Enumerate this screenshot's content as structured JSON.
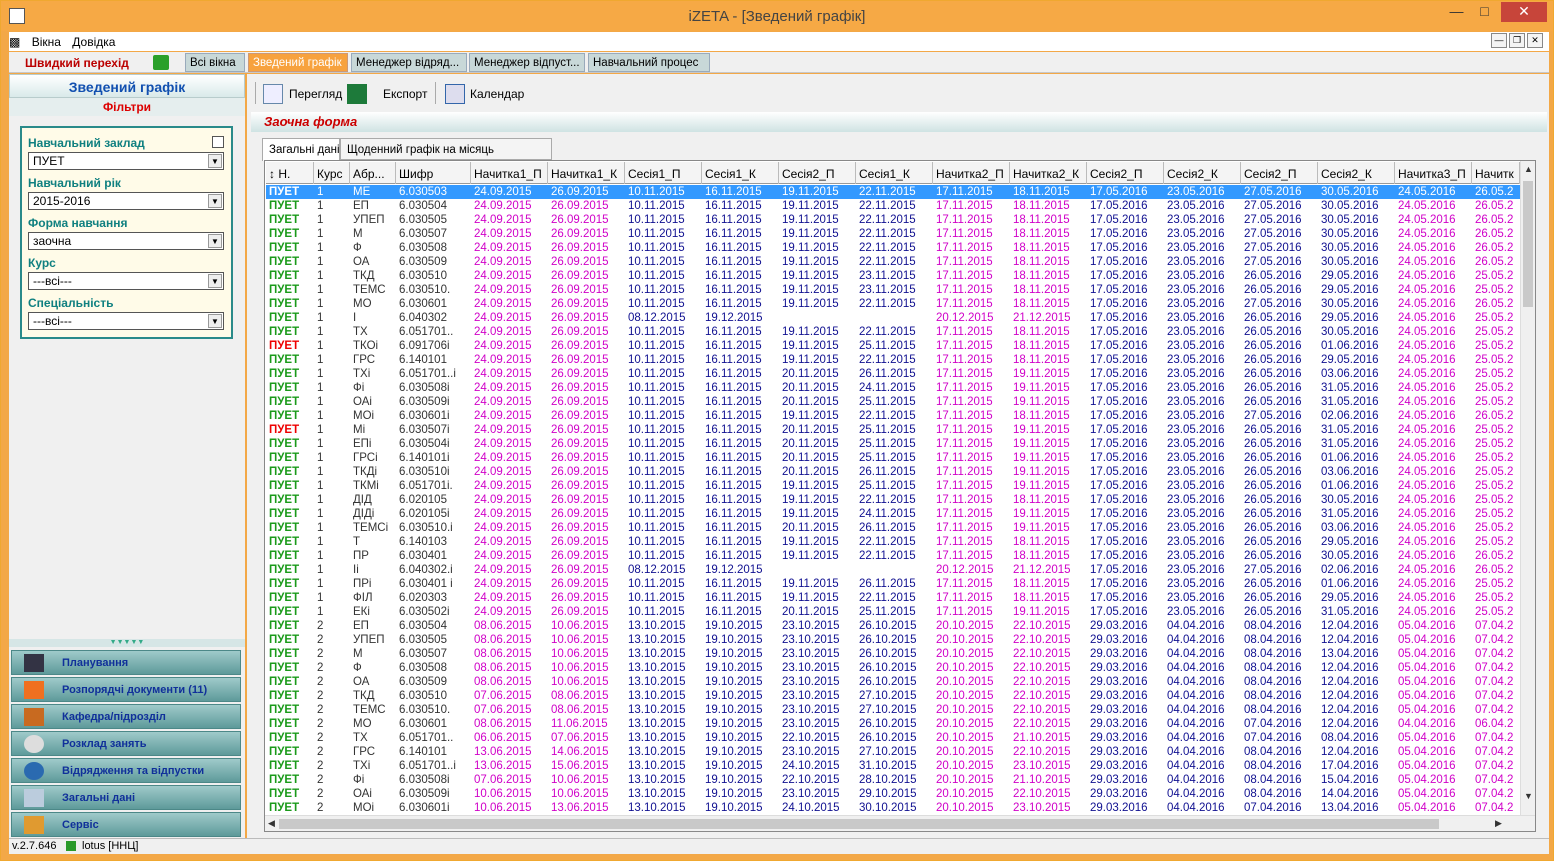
{
  "window": {
    "title": "iZETA - [Зведений графік]"
  },
  "menu": {
    "items": [
      "Вікна",
      "Довідка"
    ]
  },
  "quickbar": {
    "label": "Швидкий перехід",
    "tabs": [
      "Всі вікна",
      "Зведений графік",
      "Менеджер відряд...",
      "Менеджер відпуст...",
      "Навчальний процес"
    ],
    "active": 1
  },
  "leftpanel": {
    "title": "Зведений графік",
    "filters_title": "Фільтри",
    "filters": [
      {
        "label": "Навчальний заклад",
        "value": "ПУЕТ"
      },
      {
        "label": "Навчальний рік",
        "value": "2015-2016"
      },
      {
        "label": "Форма навчання",
        "value": "заочна"
      },
      {
        "label": "Курс",
        "value": "---всі---"
      },
      {
        "label": "Спеціальність",
        "value": "---всі---"
      }
    ],
    "nav": [
      {
        "label": "Планування",
        "icon": "graduation-icon"
      },
      {
        "label": "Розпорядчі документи (11)",
        "icon": "mail-icon"
      },
      {
        "label": "Кафедра/підрозділ",
        "icon": "briefcase-icon"
      },
      {
        "label": "Розклад занять",
        "icon": "clock-icon"
      },
      {
        "label": "Відрядження та відпустки",
        "icon": "globe-icon"
      },
      {
        "label": "Загальні дані",
        "icon": "list-icon"
      },
      {
        "label": "Сервіс",
        "icon": "tools-icon"
      }
    ]
  },
  "status": {
    "version": "v.2.7.646",
    "user": "lotus [ННЦ]"
  },
  "toolbar": {
    "preview": "Перегляд",
    "export": "Експорт",
    "calendar": "Календар"
  },
  "form_title": "Заочна форма",
  "tabs": [
    "Загальні дані",
    "Щоденний графік на місяць"
  ],
  "grid": {
    "columns": [
      "Н.",
      "Курс",
      "Абр...",
      "Шифр",
      "Начитка1_П",
      "Начитка1_К",
      "Сесія1_П",
      "Сесія1_К",
      "Сесія2_П",
      "Сесія1_К",
      "Начитка2_П",
      "Начитка2_К",
      "Сесія2_П",
      "Сесія2_К",
      "Сесія2_П",
      "Сесія2_К",
      "Начитка3_П",
      "Начитк"
    ],
    "rows": [
      [
        "ПУЕТ",
        "1",
        "МЕ",
        "6.030503",
        "24.09.2015",
        "26.09.2015",
        "10.11.2015",
        "16.11.2015",
        "19.11.2015",
        "22.11.2015",
        "17.11.2015",
        "18.11.2015",
        "17.05.2016",
        "23.05.2016",
        "27.05.2016",
        "30.05.2016",
        "24.05.2016",
        "26.05.2"
      ],
      [
        "ПУЕТ",
        "1",
        "ЕП",
        "6.030504",
        "24.09.2015",
        "26.09.2015",
        "10.11.2015",
        "16.11.2015",
        "19.11.2015",
        "22.11.2015",
        "17.11.2015",
        "18.11.2015",
        "17.05.2016",
        "23.05.2016",
        "27.05.2016",
        "30.05.2016",
        "24.05.2016",
        "26.05.2"
      ],
      [
        "ПУЕТ",
        "1",
        "УПЕП",
        "6.030505",
        "24.09.2015",
        "26.09.2015",
        "10.11.2015",
        "16.11.2015",
        "19.11.2015",
        "22.11.2015",
        "17.11.2015",
        "18.11.2015",
        "17.05.2016",
        "23.05.2016",
        "27.05.2016",
        "30.05.2016",
        "24.05.2016",
        "26.05.2"
      ],
      [
        "ПУЕТ",
        "1",
        "М",
        "6.030507",
        "24.09.2015",
        "26.09.2015",
        "10.11.2015",
        "16.11.2015",
        "19.11.2015",
        "22.11.2015",
        "17.11.2015",
        "18.11.2015",
        "17.05.2016",
        "23.05.2016",
        "27.05.2016",
        "30.05.2016",
        "24.05.2016",
        "26.05.2"
      ],
      [
        "ПУЕТ",
        "1",
        "Ф",
        "6.030508",
        "24.09.2015",
        "26.09.2015",
        "10.11.2015",
        "16.11.2015",
        "19.11.2015",
        "22.11.2015",
        "17.11.2015",
        "18.11.2015",
        "17.05.2016",
        "23.05.2016",
        "27.05.2016",
        "30.05.2016",
        "24.05.2016",
        "26.05.2"
      ],
      [
        "ПУЕТ",
        "1",
        "ОА",
        "6.030509",
        "24.09.2015",
        "26.09.2015",
        "10.11.2015",
        "16.11.2015",
        "19.11.2015",
        "22.11.2015",
        "17.11.2015",
        "18.11.2015",
        "17.05.2016",
        "23.05.2016",
        "27.05.2016",
        "30.05.2016",
        "24.05.2016",
        "26.05.2"
      ],
      [
        "ПУЕТ",
        "1",
        "ТКД",
        "6.030510",
        "24.09.2015",
        "26.09.2015",
        "10.11.2015",
        "16.11.2015",
        "19.11.2015",
        "23.11.2015",
        "17.11.2015",
        "18.11.2015",
        "17.05.2016",
        "23.05.2016",
        "26.05.2016",
        "29.05.2016",
        "24.05.2016",
        "25.05.2"
      ],
      [
        "ПУЕТ",
        "1",
        "ТЕМС",
        "6.030510.",
        "24.09.2015",
        "26.09.2015",
        "10.11.2015",
        "16.11.2015",
        "19.11.2015",
        "23.11.2015",
        "17.11.2015",
        "18.11.2015",
        "17.05.2016",
        "23.05.2016",
        "26.05.2016",
        "29.05.2016",
        "24.05.2016",
        "25.05.2"
      ],
      [
        "ПУЕТ",
        "1",
        "МО",
        "6.030601",
        "24.09.2015",
        "26.09.2015",
        "10.11.2015",
        "16.11.2015",
        "19.11.2015",
        "22.11.2015",
        "17.11.2015",
        "18.11.2015",
        "17.05.2016",
        "23.05.2016",
        "27.05.2016",
        "30.05.2016",
        "24.05.2016",
        "26.05.2"
      ],
      [
        "ПУЕТ",
        "1",
        "І",
        "6.040302",
        "24.09.2015",
        "26.09.2015",
        "08.12.2015",
        "19.12.2015",
        "",
        "",
        "20.12.2015",
        "21.12.2015",
        "17.05.2016",
        "23.05.2016",
        "26.05.2016",
        "29.05.2016",
        "24.05.2016",
        "25.05.2"
      ],
      [
        "ПУЕТ",
        "1",
        "ТХ",
        "6.051701..",
        "24.09.2015",
        "26.09.2015",
        "10.11.2015",
        "16.11.2015",
        "19.11.2015",
        "22.11.2015",
        "17.11.2015",
        "18.11.2015",
        "17.05.2016",
        "23.05.2016",
        "26.05.2016",
        "30.05.2016",
        "24.05.2016",
        "25.05.2"
      ],
      [
        "ПУЕТ",
        "1",
        "ТКОі",
        "6.091706і",
        "24.09.2015",
        "26.09.2015",
        "10.11.2015",
        "16.11.2015",
        "19.11.2015",
        "25.11.2015",
        "17.11.2015",
        "18.11.2015",
        "17.05.2016",
        "23.05.2016",
        "26.05.2016",
        "01.06.2016",
        "24.05.2016",
        "25.05.2"
      ],
      [
        "ПУЕТ",
        "1",
        "ГРС",
        "6.140101",
        "24.09.2015",
        "26.09.2015",
        "10.11.2015",
        "16.11.2015",
        "19.11.2015",
        "22.11.2015",
        "17.11.2015",
        "18.11.2015",
        "17.05.2016",
        "23.05.2016",
        "26.05.2016",
        "29.05.2016",
        "24.05.2016",
        "25.05.2"
      ],
      [
        "ПУЕТ",
        "1",
        "ТХі",
        "6.051701..і",
        "24.09.2015",
        "26.09.2015",
        "10.11.2015",
        "16.11.2015",
        "20.11.2015",
        "26.11.2015",
        "17.11.2015",
        "19.11.2015",
        "17.05.2016",
        "23.05.2016",
        "26.05.2016",
        "03.06.2016",
        "24.05.2016",
        "25.05.2"
      ],
      [
        "ПУЕТ",
        "1",
        "Фі",
        "6.030508і",
        "24.09.2015",
        "26.09.2015",
        "10.11.2015",
        "16.11.2015",
        "20.11.2015",
        "24.11.2015",
        "17.11.2015",
        "19.11.2015",
        "17.05.2016",
        "23.05.2016",
        "26.05.2016",
        "31.05.2016",
        "24.05.2016",
        "25.05.2"
      ],
      [
        "ПУЕТ",
        "1",
        "ОАі",
        "6.030509і",
        "24.09.2015",
        "26.09.2015",
        "10.11.2015",
        "16.11.2015",
        "20.11.2015",
        "25.11.2015",
        "17.11.2015",
        "19.11.2015",
        "17.05.2016",
        "23.05.2016",
        "26.05.2016",
        "31.05.2016",
        "24.05.2016",
        "25.05.2"
      ],
      [
        "ПУЕТ",
        "1",
        "МОі",
        "6.030601і",
        "24.09.2015",
        "26.09.2015",
        "10.11.2015",
        "16.11.2015",
        "19.11.2015",
        "22.11.2015",
        "17.11.2015",
        "18.11.2015",
        "17.05.2016",
        "23.05.2016",
        "27.05.2016",
        "02.06.2016",
        "24.05.2016",
        "26.05.2"
      ],
      [
        "ПУЕТ",
        "1",
        "Мі",
        "6.030507і",
        "24.09.2015",
        "26.09.2015",
        "10.11.2015",
        "16.11.2015",
        "20.11.2015",
        "25.11.2015",
        "17.11.2015",
        "19.11.2015",
        "17.05.2016",
        "23.05.2016",
        "26.05.2016",
        "31.05.2016",
        "24.05.2016",
        "25.05.2"
      ],
      [
        "ПУЕТ",
        "1",
        "ЕПі",
        "6.030504і",
        "24.09.2015",
        "26.09.2015",
        "10.11.2015",
        "16.11.2015",
        "20.11.2015",
        "25.11.2015",
        "17.11.2015",
        "19.11.2015",
        "17.05.2016",
        "23.05.2016",
        "26.05.2016",
        "31.05.2016",
        "24.05.2016",
        "25.05.2"
      ],
      [
        "ПУЕТ",
        "1",
        "ГРСі",
        "6.140101і",
        "24.09.2015",
        "26.09.2015",
        "10.11.2015",
        "16.11.2015",
        "20.11.2015",
        "25.11.2015",
        "17.11.2015",
        "19.11.2015",
        "17.05.2016",
        "23.05.2016",
        "26.05.2016",
        "01.06.2016",
        "24.05.2016",
        "25.05.2"
      ],
      [
        "ПУЕТ",
        "1",
        "ТКДі",
        "6.030510і",
        "24.09.2015",
        "26.09.2015",
        "10.11.2015",
        "16.11.2015",
        "20.11.2015",
        "26.11.2015",
        "17.11.2015",
        "19.11.2015",
        "17.05.2016",
        "23.05.2016",
        "26.05.2016",
        "03.06.2016",
        "24.05.2016",
        "25.05.2"
      ],
      [
        "ПУЕТ",
        "1",
        "ТКМі",
        "6.051701і.",
        "24.09.2015",
        "26.09.2015",
        "10.11.2015",
        "16.11.2015",
        "19.11.2015",
        "25.11.2015",
        "17.11.2015",
        "19.11.2015",
        "17.05.2016",
        "23.05.2016",
        "26.05.2016",
        "01.06.2016",
        "24.05.2016",
        "25.05.2"
      ],
      [
        "ПУЕТ",
        "1",
        "ДІД",
        "6.020105",
        "24.09.2015",
        "26.09.2015",
        "10.11.2015",
        "16.11.2015",
        "19.11.2015",
        "22.11.2015",
        "17.11.2015",
        "18.11.2015",
        "17.05.2016",
        "23.05.2016",
        "26.05.2016",
        "30.05.2016",
        "24.05.2016",
        "25.05.2"
      ],
      [
        "ПУЕТ",
        "1",
        "ДІДі",
        "6.020105і",
        "24.09.2015",
        "26.09.2015",
        "10.11.2015",
        "16.11.2015",
        "19.11.2015",
        "24.11.2015",
        "17.11.2015",
        "19.11.2015",
        "17.05.2016",
        "23.05.2016",
        "26.05.2016",
        "31.05.2016",
        "24.05.2016",
        "25.05.2"
      ],
      [
        "ПУЕТ",
        "1",
        "ТЕМСі",
        "6.030510.і",
        "24.09.2015",
        "26.09.2015",
        "10.11.2015",
        "16.11.2015",
        "20.11.2015",
        "26.11.2015",
        "17.11.2015",
        "19.11.2015",
        "17.05.2016",
        "23.05.2016",
        "26.05.2016",
        "03.06.2016",
        "24.05.2016",
        "25.05.2"
      ],
      [
        "ПУЕТ",
        "1",
        "Т",
        "6.140103",
        "24.09.2015",
        "26.09.2015",
        "10.11.2015",
        "16.11.2015",
        "19.11.2015",
        "22.11.2015",
        "17.11.2015",
        "18.11.2015",
        "17.05.2016",
        "23.05.2016",
        "26.05.2016",
        "29.05.2016",
        "24.05.2016",
        "25.05.2"
      ],
      [
        "ПУЕТ",
        "1",
        "ПР",
        "6.030401",
        "24.09.2015",
        "26.09.2015",
        "10.11.2015",
        "16.11.2015",
        "19.11.2015",
        "22.11.2015",
        "17.11.2015",
        "18.11.2015",
        "17.05.2016",
        "23.05.2016",
        "26.05.2016",
        "30.05.2016",
        "24.05.2016",
        "26.05.2"
      ],
      [
        "ПУЕТ",
        "1",
        "Іі",
        "6.040302.і",
        "24.09.2015",
        "26.09.2015",
        "08.12.2015",
        "19.12.2015",
        "",
        "",
        "20.12.2015",
        "21.12.2015",
        "17.05.2016",
        "23.05.2016",
        "27.05.2016",
        "02.06.2016",
        "24.05.2016",
        "26.05.2"
      ],
      [
        "ПУЕТ",
        "1",
        "ПРі",
        "6.030401 і",
        "24.09.2015",
        "26.09.2015",
        "10.11.2015",
        "16.11.2015",
        "19.11.2015",
        "26.11.2015",
        "17.11.2015",
        "18.11.2015",
        "17.05.2016",
        "23.05.2016",
        "26.05.2016",
        "01.06.2016",
        "24.05.2016",
        "25.05.2"
      ],
      [
        "ПУЕТ",
        "1",
        "ФІЛ",
        "6.020303",
        "24.09.2015",
        "26.09.2015",
        "10.11.2015",
        "16.11.2015",
        "19.11.2015",
        "22.11.2015",
        "17.11.2015",
        "18.11.2015",
        "17.05.2016",
        "23.05.2016",
        "26.05.2016",
        "29.05.2016",
        "24.05.2016",
        "25.05.2"
      ],
      [
        "ПУЕТ",
        "1",
        "ЕКі",
        "6.030502і",
        "24.09.2015",
        "26.09.2015",
        "10.11.2015",
        "16.11.2015",
        "20.11.2015",
        "25.11.2015",
        "17.11.2015",
        "19.11.2015",
        "17.05.2016",
        "23.05.2016",
        "26.05.2016",
        "31.05.2016",
        "24.05.2016",
        "25.05.2"
      ],
      [
        "ПУЕТ",
        "2",
        "ЕП",
        "6.030504",
        "08.06.2015",
        "10.06.2015",
        "13.10.2015",
        "19.10.2015",
        "23.10.2015",
        "26.10.2015",
        "20.10.2015",
        "22.10.2015",
        "29.03.2016",
        "04.04.2016",
        "08.04.2016",
        "12.04.2016",
        "05.04.2016",
        "07.04.2"
      ],
      [
        "ПУЕТ",
        "2",
        "УПЕП",
        "6.030505",
        "08.06.2015",
        "10.06.2015",
        "13.10.2015",
        "19.10.2015",
        "23.10.2015",
        "26.10.2015",
        "20.10.2015",
        "22.10.2015",
        "29.03.2016",
        "04.04.2016",
        "08.04.2016",
        "12.04.2016",
        "05.04.2016",
        "07.04.2"
      ],
      [
        "ПУЕТ",
        "2",
        "М",
        "6.030507",
        "08.06.2015",
        "10.06.2015",
        "13.10.2015",
        "19.10.2015",
        "23.10.2015",
        "26.10.2015",
        "20.10.2015",
        "22.10.2015",
        "29.03.2016",
        "04.04.2016",
        "08.04.2016",
        "13.04.2016",
        "05.04.2016",
        "07.04.2"
      ],
      [
        "ПУЕТ",
        "2",
        "Ф",
        "6.030508",
        "08.06.2015",
        "10.06.2015",
        "13.10.2015",
        "19.10.2015",
        "23.10.2015",
        "26.10.2015",
        "20.10.2015",
        "22.10.2015",
        "29.03.2016",
        "04.04.2016",
        "08.04.2016",
        "12.04.2016",
        "05.04.2016",
        "07.04.2"
      ],
      [
        "ПУЕТ",
        "2",
        "ОА",
        "6.030509",
        "08.06.2015",
        "10.06.2015",
        "13.10.2015",
        "19.10.2015",
        "23.10.2015",
        "26.10.2015",
        "20.10.2015",
        "22.10.2015",
        "29.03.2016",
        "04.04.2016",
        "08.04.2016",
        "12.04.2016",
        "05.04.2016",
        "07.04.2"
      ],
      [
        "ПУЕТ",
        "2",
        "ТКД",
        "6.030510",
        "07.06.2015",
        "08.06.2015",
        "13.10.2015",
        "19.10.2015",
        "23.10.2015",
        "27.10.2015",
        "20.10.2015",
        "22.10.2015",
        "29.03.2016",
        "04.04.2016",
        "08.04.2016",
        "12.04.2016",
        "05.04.2016",
        "07.04.2"
      ],
      [
        "ПУЕТ",
        "2",
        "ТЕМС",
        "6.030510.",
        "07.06.2015",
        "08.06.2015",
        "13.10.2015",
        "19.10.2015",
        "23.10.2015",
        "27.10.2015",
        "20.10.2015",
        "22.10.2015",
        "29.03.2016",
        "04.04.2016",
        "08.04.2016",
        "12.04.2016",
        "05.04.2016",
        "07.04.2"
      ],
      [
        "ПУЕТ",
        "2",
        "МО",
        "6.030601",
        "08.06.2015",
        "11.06.2015",
        "13.10.2015",
        "19.10.2015",
        "23.10.2015",
        "26.10.2015",
        "20.10.2015",
        "22.10.2015",
        "29.03.2016",
        "04.04.2016",
        "07.04.2016",
        "12.04.2016",
        "04.04.2016",
        "06.04.2"
      ],
      [
        "ПУЕТ",
        "2",
        "ТХ",
        "6.051701..",
        "06.06.2015",
        "07.06.2015",
        "13.10.2015",
        "19.10.2015",
        "22.10.2015",
        "26.10.2015",
        "20.10.2015",
        "21.10.2015",
        "29.03.2016",
        "04.04.2016",
        "07.04.2016",
        "08.04.2016",
        "05.04.2016",
        "07.04.2"
      ],
      [
        "ПУЕТ",
        "2",
        "ГРС",
        "6.140101",
        "13.06.2015",
        "14.06.2015",
        "13.10.2015",
        "19.10.2015",
        "23.10.2015",
        "27.10.2015",
        "20.10.2015",
        "22.10.2015",
        "29.03.2016",
        "04.04.2016",
        "08.04.2016",
        "12.04.2016",
        "05.04.2016",
        "07.04.2"
      ],
      [
        "ПУЕТ",
        "2",
        "ТХі",
        "6.051701..і",
        "13.06.2015",
        "15.06.2015",
        "13.10.2015",
        "19.10.2015",
        "24.10.2015",
        "31.10.2015",
        "20.10.2015",
        "23.10.2015",
        "29.03.2016",
        "04.04.2016",
        "08.04.2016",
        "17.04.2016",
        "05.04.2016",
        "07.04.2"
      ],
      [
        "ПУЕТ",
        "2",
        "Фі",
        "6.030508і",
        "07.06.2015",
        "10.06.2015",
        "13.10.2015",
        "19.10.2015",
        "22.10.2015",
        "28.10.2015",
        "20.10.2015",
        "21.10.2015",
        "29.03.2016",
        "04.04.2016",
        "08.04.2016",
        "15.04.2016",
        "05.04.2016",
        "07.04.2"
      ],
      [
        "ПУЕТ",
        "2",
        "ОАі",
        "6.030509і",
        "10.06.2015",
        "10.06.2015",
        "13.10.2015",
        "19.10.2015",
        "23.10.2015",
        "29.10.2015",
        "20.10.2015",
        "22.10.2015",
        "29.03.2016",
        "04.04.2016",
        "08.04.2016",
        "14.04.2016",
        "05.04.2016",
        "07.04.2"
      ],
      [
        "ПУЕТ",
        "2",
        "МОі",
        "6.030601і",
        "10.06.2015",
        "13.06.2015",
        "13.10.2015",
        "19.10.2015",
        "24.10.2015",
        "30.10.2015",
        "20.10.2015",
        "23.10.2015",
        "29.03.2016",
        "04.04.2016",
        "07.04.2016",
        "13.04.2016",
        "05.04.2016",
        "07.04.2"
      ]
    ],
    "red_rows": [
      11,
      17
    ]
  }
}
